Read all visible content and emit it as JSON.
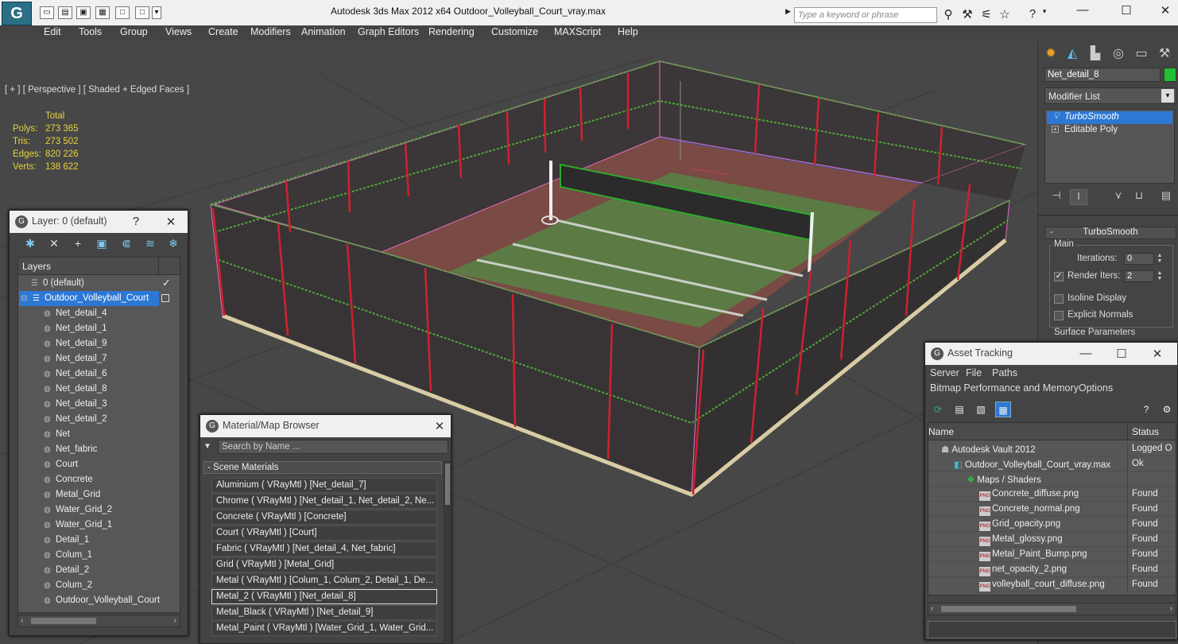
{
  "titlebar": {
    "title": "Autodesk 3ds Max  2012 x64        Outdoor_Volleyball_Court_vray.max",
    "search_placeholder": "Type a keyword or phrase"
  },
  "menu": [
    "Edit",
    "Tools",
    "Group",
    "Views",
    "Create",
    "Modifiers",
    "Animation",
    "Graph Editors",
    "Rendering",
    "Customize",
    "MAXScript",
    "Help"
  ],
  "viewport": {
    "label": "[ + ] [ Perspective ] [ Shaded + Edged Faces ]",
    "stats": {
      "header": "Total",
      "rows": [
        {
          "k": "Polys:",
          "v": "273 365"
        },
        {
          "k": "Tris:",
          "v": "273 502"
        },
        {
          "k": "Edges:",
          "v": "820 226"
        },
        {
          "k": "Verts:",
          "v": "138 622"
        }
      ]
    }
  },
  "command_panel": {
    "object_name": "Net_detail_8",
    "object_color": "#22c033",
    "modifier_list": "Modifier List",
    "stack": [
      "TurboSmooth",
      "Editable Poly"
    ],
    "rollout_title": "TurboSmooth",
    "main_label": "Main",
    "iterations_label": "Iterations:",
    "iterations_value": "0",
    "render_iters_label": "Render Iters:",
    "render_iters_value": "2",
    "isoline_label": "Isoline Display",
    "explicit_normals_label": "Explicit Normals",
    "surface_params_label": "Surface Parameters"
  },
  "layer_window": {
    "title": "Layer: 0 (default)",
    "help": "?",
    "header": "Layers",
    "rows": [
      {
        "label": "0 (default)",
        "level": 1,
        "selected": false
      },
      {
        "label": "Outdoor_Volleyball_Court",
        "level": 1,
        "selected": true
      },
      {
        "label": "Net_detail_4",
        "level": 2
      },
      {
        "label": "Net_detail_1",
        "level": 2
      },
      {
        "label": "Net_detail_9",
        "level": 2
      },
      {
        "label": "Net_detail_7",
        "level": 2
      },
      {
        "label": "Net_detail_6",
        "level": 2
      },
      {
        "label": "Net_detail_8",
        "level": 2
      },
      {
        "label": "Net_detail_3",
        "level": 2
      },
      {
        "label": "Net_detail_2",
        "level": 2
      },
      {
        "label": "Net",
        "level": 2
      },
      {
        "label": "Net_fabric",
        "level": 2
      },
      {
        "label": "Court",
        "level": 2
      },
      {
        "label": "Concrete",
        "level": 2
      },
      {
        "label": "Metal_Grid",
        "level": 2
      },
      {
        "label": "Water_Grid_2",
        "level": 2
      },
      {
        "label": "Water_Grid_1",
        "level": 2
      },
      {
        "label": "Detail_1",
        "level": 2
      },
      {
        "label": "Colum_1",
        "level": 2
      },
      {
        "label": "Detail_2",
        "level": 2
      },
      {
        "label": "Colum_2",
        "level": 2
      },
      {
        "label": "Outdoor_Volleyball_Court",
        "level": 2
      }
    ]
  },
  "material_browser": {
    "title": "Material/Map Browser",
    "search_placeholder": "Search by Name ...",
    "group": "- Scene Materials",
    "rows": [
      "Aluminium  ( VRayMtl ) [Net_detail_7]",
      "Chrome  ( VRayMtl ) [Net_detail_1, Net_detail_2, Ne...",
      "Concrete  ( VRayMtl ) [Concrete]",
      "Court  ( VRayMtl ) [Court]",
      "Fabric  ( VRayMtl ) [Net_detail_4, Net_fabric]",
      "Grid  ( VRayMtl ) [Metal_Grid]",
      "Metal  ( VRayMtl ) [Colum_1, Colum_2, Detail_1, De...",
      "Metal_2  ( VRayMtl ) [Net_detail_8]",
      "Metal_Black  ( VRayMtl ) [Net_detail_9]",
      "Metal_Paint  ( VRayMtl ) [Water_Grid_1, Water_Grid..."
    ],
    "selected_index": 7
  },
  "asset_tracking": {
    "title": "Asset Tracking",
    "menu1": [
      "Server",
      "File",
      "Paths"
    ],
    "menu2": [
      "Bitmap Performance and Memory",
      "Options"
    ],
    "col_name": "Name",
    "col_status": "Status",
    "rows": [
      {
        "name": "Autodesk Vault 2012",
        "status": "Logged O",
        "indent": 16,
        "icon": "vault"
      },
      {
        "name": "Outdoor_Volleyball_Court_vray.max",
        "status": "Ok",
        "indent": 32,
        "icon": "max"
      },
      {
        "name": "Maps / Shaders",
        "status": "",
        "indent": 48,
        "icon": "maps"
      },
      {
        "name": "Concrete_diffuse.png",
        "status": "Found",
        "indent": 64,
        "icon": "png"
      },
      {
        "name": "Concrete_normal.png",
        "status": "Found",
        "indent": 64,
        "icon": "png"
      },
      {
        "name": "Grid_opacity.png",
        "status": "Found",
        "indent": 64,
        "icon": "png"
      },
      {
        "name": "Metal_glossy.png",
        "status": "Found",
        "indent": 64,
        "icon": "png"
      },
      {
        "name": "Metal_Paint_Bump.png",
        "status": "Found",
        "indent": 64,
        "icon": "png"
      },
      {
        "name": "net_opacity_2.png",
        "status": "Found",
        "indent": 64,
        "icon": "png"
      },
      {
        "name": "volleyball_court_diffuse.png",
        "status": "Found",
        "indent": 64,
        "icon": "png"
      }
    ]
  }
}
